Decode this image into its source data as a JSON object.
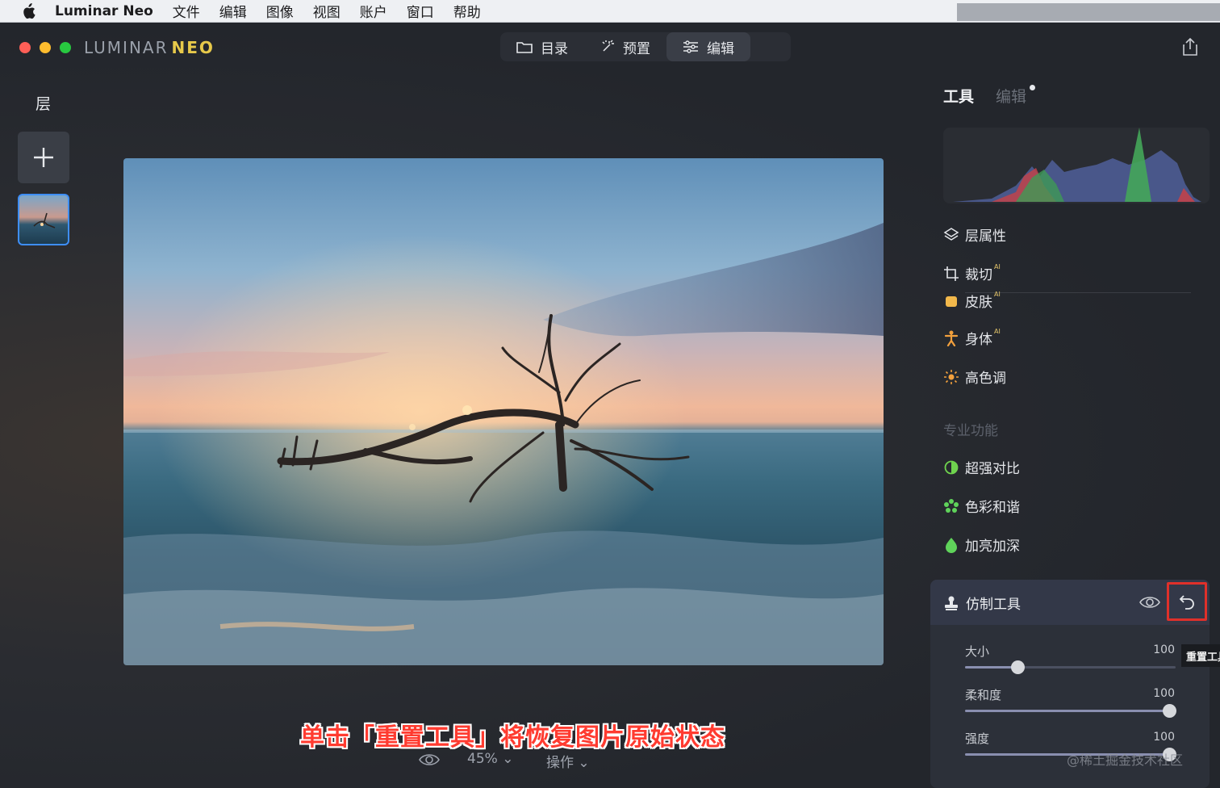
{
  "menubar": {
    "app_name": "Luminar Neo",
    "items": [
      "文件",
      "编辑",
      "图像",
      "视图",
      "账户",
      "窗口",
      "帮助"
    ]
  },
  "window": {
    "brand_part1": "LUMINAR",
    "brand_part2": "NEO",
    "tabs": [
      {
        "label": "目录",
        "icon": "folder-icon"
      },
      {
        "label": "预置",
        "icon": "magic-wand-icon"
      },
      {
        "label": "编辑",
        "icon": "sliders-icon",
        "active": true
      }
    ]
  },
  "layers": {
    "title": "层"
  },
  "canvas": {
    "zoom": "45%",
    "operations_label": "操作"
  },
  "caption": "单击「重置工具」将恢复图片原始状态",
  "right_panel": {
    "tab_tools": "工具",
    "tab_edit": "编辑",
    "tools": [
      {
        "label": "层属性",
        "icon": "layers-icon",
        "ai": false
      },
      {
        "label": "裁切",
        "icon": "crop-icon",
        "ai": true
      },
      {
        "label": "皮肤",
        "icon": "skin-icon",
        "ai": true
      },
      {
        "label": "身体",
        "icon": "body-icon",
        "ai": true
      },
      {
        "label": "高色调",
        "icon": "high-key-icon",
        "ai": false
      }
    ],
    "ai_tag": "AI",
    "section_title": "专业功能",
    "pro_tools": [
      {
        "label": "超强对比",
        "icon": "contrast-icon"
      },
      {
        "label": "色彩和谐",
        "icon": "color-harmony-icon"
      },
      {
        "label": "加亮加深",
        "icon": "dodge-burn-icon"
      }
    ],
    "clone_tool": {
      "title": "仿制工具",
      "reset_tooltip": "重置工具",
      "sliders": [
        {
          "label": "大小",
          "value": "100",
          "fraction": 0.25
        },
        {
          "label": "柔和度",
          "value": "100",
          "fraction": 0.97
        },
        {
          "label": "强度",
          "value": "100",
          "fraction": 0.97
        }
      ]
    }
  },
  "watermark": "@稀土掘金技术社区",
  "colors": {
    "accent_blue": "#3e8ef7",
    "highlight_red": "#e0302a",
    "brand_yellow": "#e7c94a"
  }
}
